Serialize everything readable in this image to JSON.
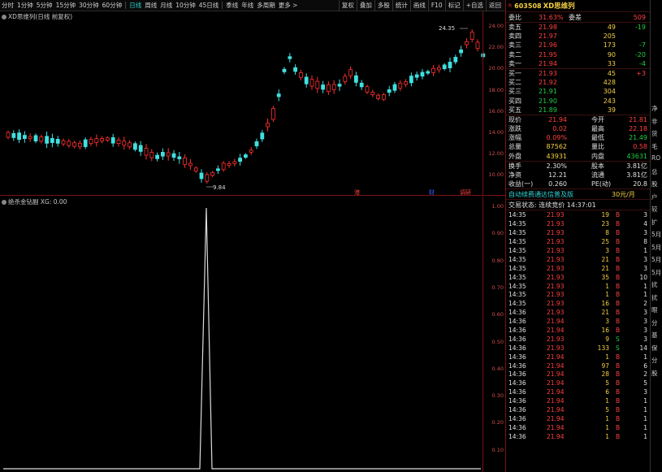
{
  "toolbar": {
    "periods": [
      "分时",
      "1分钟",
      "5分钟",
      "15分钟",
      "30分钟",
      "60分钟",
      "日线",
      "周线",
      "月线",
      "10分钟",
      "45日线",
      "季线",
      "年线",
      "多周期",
      "更多 >"
    ],
    "active_period": "日线",
    "right_buttons": [
      "复权",
      "叠加",
      "多股",
      "统计",
      "画线",
      "F10",
      "标记",
      "+自选",
      "返回"
    ]
  },
  "main_chart": {
    "title": "XD思维列(日线 前复权)",
    "y_ticks": [
      "24.00",
      "22.00",
      "20.00",
      "18.00",
      "16.00",
      "14.00",
      "12.00",
      "10.00"
    ],
    "high_label": "24.35",
    "low_label": "9.84",
    "markers": [
      "港",
      "财",
      "调研"
    ],
    "colors": {
      "up": "#ff3030",
      "down": "#40e0e0",
      "axis": "#7a1010"
    }
  },
  "indicator": {
    "title": "绝杀金钻副 XG: 0.00",
    "y_ticks": [
      "1.00",
      "0.90",
      "0.80",
      "0.70",
      "0.60",
      "0.50",
      "0.40",
      "0.30",
      "0.20",
      "0.10"
    ]
  },
  "quote": {
    "code": "603508",
    "name": "XD思维列",
    "weibi_label": "委比",
    "weibi_value": "31.63%",
    "weicha_label": "委差",
    "weicha_value": "509",
    "asks": [
      {
        "label": "卖五",
        "price": "21.98",
        "vol": "49",
        "chg": "-19"
      },
      {
        "label": "卖四",
        "price": "21.97",
        "vol": "205",
        "chg": ""
      },
      {
        "label": "卖三",
        "price": "21.96",
        "vol": "173",
        "chg": "-7"
      },
      {
        "label": "卖二",
        "price": "21.95",
        "vol": "90",
        "chg": "-20"
      },
      {
        "label": "卖一",
        "price": "21.94",
        "vol": "33",
        "chg": "-4"
      }
    ],
    "bids": [
      {
        "label": "买一",
        "price": "21.93",
        "vol": "45",
        "chg": "+3"
      },
      {
        "label": "买二",
        "price": "21.92",
        "vol": "428",
        "chg": ""
      },
      {
        "label": "买三",
        "price": "21.91",
        "vol": "304",
        "chg": ""
      },
      {
        "label": "买四",
        "price": "21.90",
        "vol": "243",
        "chg": ""
      },
      {
        "label": "买五",
        "price": "21.89",
        "vol": "39",
        "chg": ""
      }
    ],
    "stats": [
      {
        "l1": "现价",
        "v1": "21.94",
        "l2": "今开",
        "v2": "21.81"
      },
      {
        "l1": "涨跌",
        "v1": "0.02",
        "l2": "最高",
        "v2": "22.18"
      },
      {
        "l1": "涨幅",
        "v1": "0.09%",
        "l2": "最低",
        "v2": "21.49"
      },
      {
        "l1": "总量",
        "v1": "87562",
        "l2": "量比",
        "v2": "0.58"
      },
      {
        "l1": "外盘",
        "v1": "43931",
        "l2": "内盘",
        "v2": "43631"
      }
    ],
    "stats2": [
      {
        "l1": "换手",
        "v1": "2.30%",
        "l2": "股本",
        "v2": "3.81亿"
      },
      {
        "l1": "净资",
        "v1": "12.21",
        "l2": "流通",
        "v2": "3.81亿"
      },
      {
        "l1": "收益(一)",
        "v1": "0.260",
        "l2": "PE(动)",
        "v2": "20.8"
      }
    ],
    "promo": "自动续费通达信普及版",
    "promo_price": "30元/月",
    "trade_status": "交易状态: 连续竞价 14:37:01"
  },
  "ticks": [
    {
      "t": "14:35",
      "p": "21.93",
      "v": "19",
      "bs": "B",
      "n": "3"
    },
    {
      "t": "14:35",
      "p": "21.93",
      "v": "23",
      "bs": "B",
      "n": "4"
    },
    {
      "t": "14:35",
      "p": "21.93",
      "v": "8",
      "bs": "B",
      "n": "3"
    },
    {
      "t": "14:35",
      "p": "21.93",
      "v": "25",
      "bs": "B",
      "n": "8"
    },
    {
      "t": "14:35",
      "p": "21.93",
      "v": "3",
      "bs": "B",
      "n": "1"
    },
    {
      "t": "14:35",
      "p": "21.93",
      "v": "21",
      "bs": "B",
      "n": "3"
    },
    {
      "t": "14:35",
      "p": "21.93",
      "v": "21",
      "bs": "B",
      "n": "3"
    },
    {
      "t": "14:35",
      "p": "21.93",
      "v": "35",
      "bs": "B",
      "n": "10"
    },
    {
      "t": "14:35",
      "p": "21.93",
      "v": "1",
      "bs": "B",
      "n": "1"
    },
    {
      "t": "14:35",
      "p": "21.93",
      "v": "1",
      "bs": "B",
      "n": "1"
    },
    {
      "t": "14:35",
      "p": "21.93",
      "v": "16",
      "bs": "B",
      "n": "2"
    },
    {
      "t": "14:36",
      "p": "21.93",
      "v": "21",
      "bs": "B",
      "n": "3"
    },
    {
      "t": "14:36",
      "p": "21.94",
      "v": "3",
      "bs": "B",
      "n": "3"
    },
    {
      "t": "14:36",
      "p": "21.94",
      "v": "16",
      "bs": "B",
      "n": "3"
    },
    {
      "t": "14:36",
      "p": "21.93",
      "v": "9",
      "bs": "S",
      "n": "3"
    },
    {
      "t": "14:36",
      "p": "21.93",
      "v": "133",
      "bs": "S",
      "n": "14"
    },
    {
      "t": "14:36",
      "p": "21.94",
      "v": "1",
      "bs": "B",
      "n": "1"
    },
    {
      "t": "14:36",
      "p": "21.94",
      "v": "97",
      "bs": "B",
      "n": "6"
    },
    {
      "t": "14:36",
      "p": "21.94",
      "v": "28",
      "bs": "B",
      "n": "2"
    },
    {
      "t": "14:36",
      "p": "21.94",
      "v": "5",
      "bs": "B",
      "n": "5"
    },
    {
      "t": "14:36",
      "p": "21.94",
      "v": "6",
      "bs": "B",
      "n": "3"
    },
    {
      "t": "14:36",
      "p": "21.94",
      "v": "1",
      "bs": "B",
      "n": "1"
    },
    {
      "t": "14:36",
      "p": "21.94",
      "v": "5",
      "bs": "B",
      "n": "1"
    },
    {
      "t": "14:36",
      "p": "21.94",
      "v": "1",
      "bs": "B",
      "n": "1"
    },
    {
      "t": "14:36",
      "p": "21.94",
      "v": "1",
      "bs": "B",
      "n": "1"
    },
    {
      "t": "14:36",
      "p": "21.94",
      "v": "1",
      "bs": "B",
      "n": "1"
    }
  ],
  "stub": [
    "净",
    "非",
    "货",
    "毛",
    "RO",
    "总",
    "股",
    "户",
    "较",
    "扩",
    "5月",
    "5月",
    "5月",
    "5月",
    "扰",
    "扰",
    "眼",
    "分",
    "基",
    "保",
    "分",
    "股"
  ]
}
